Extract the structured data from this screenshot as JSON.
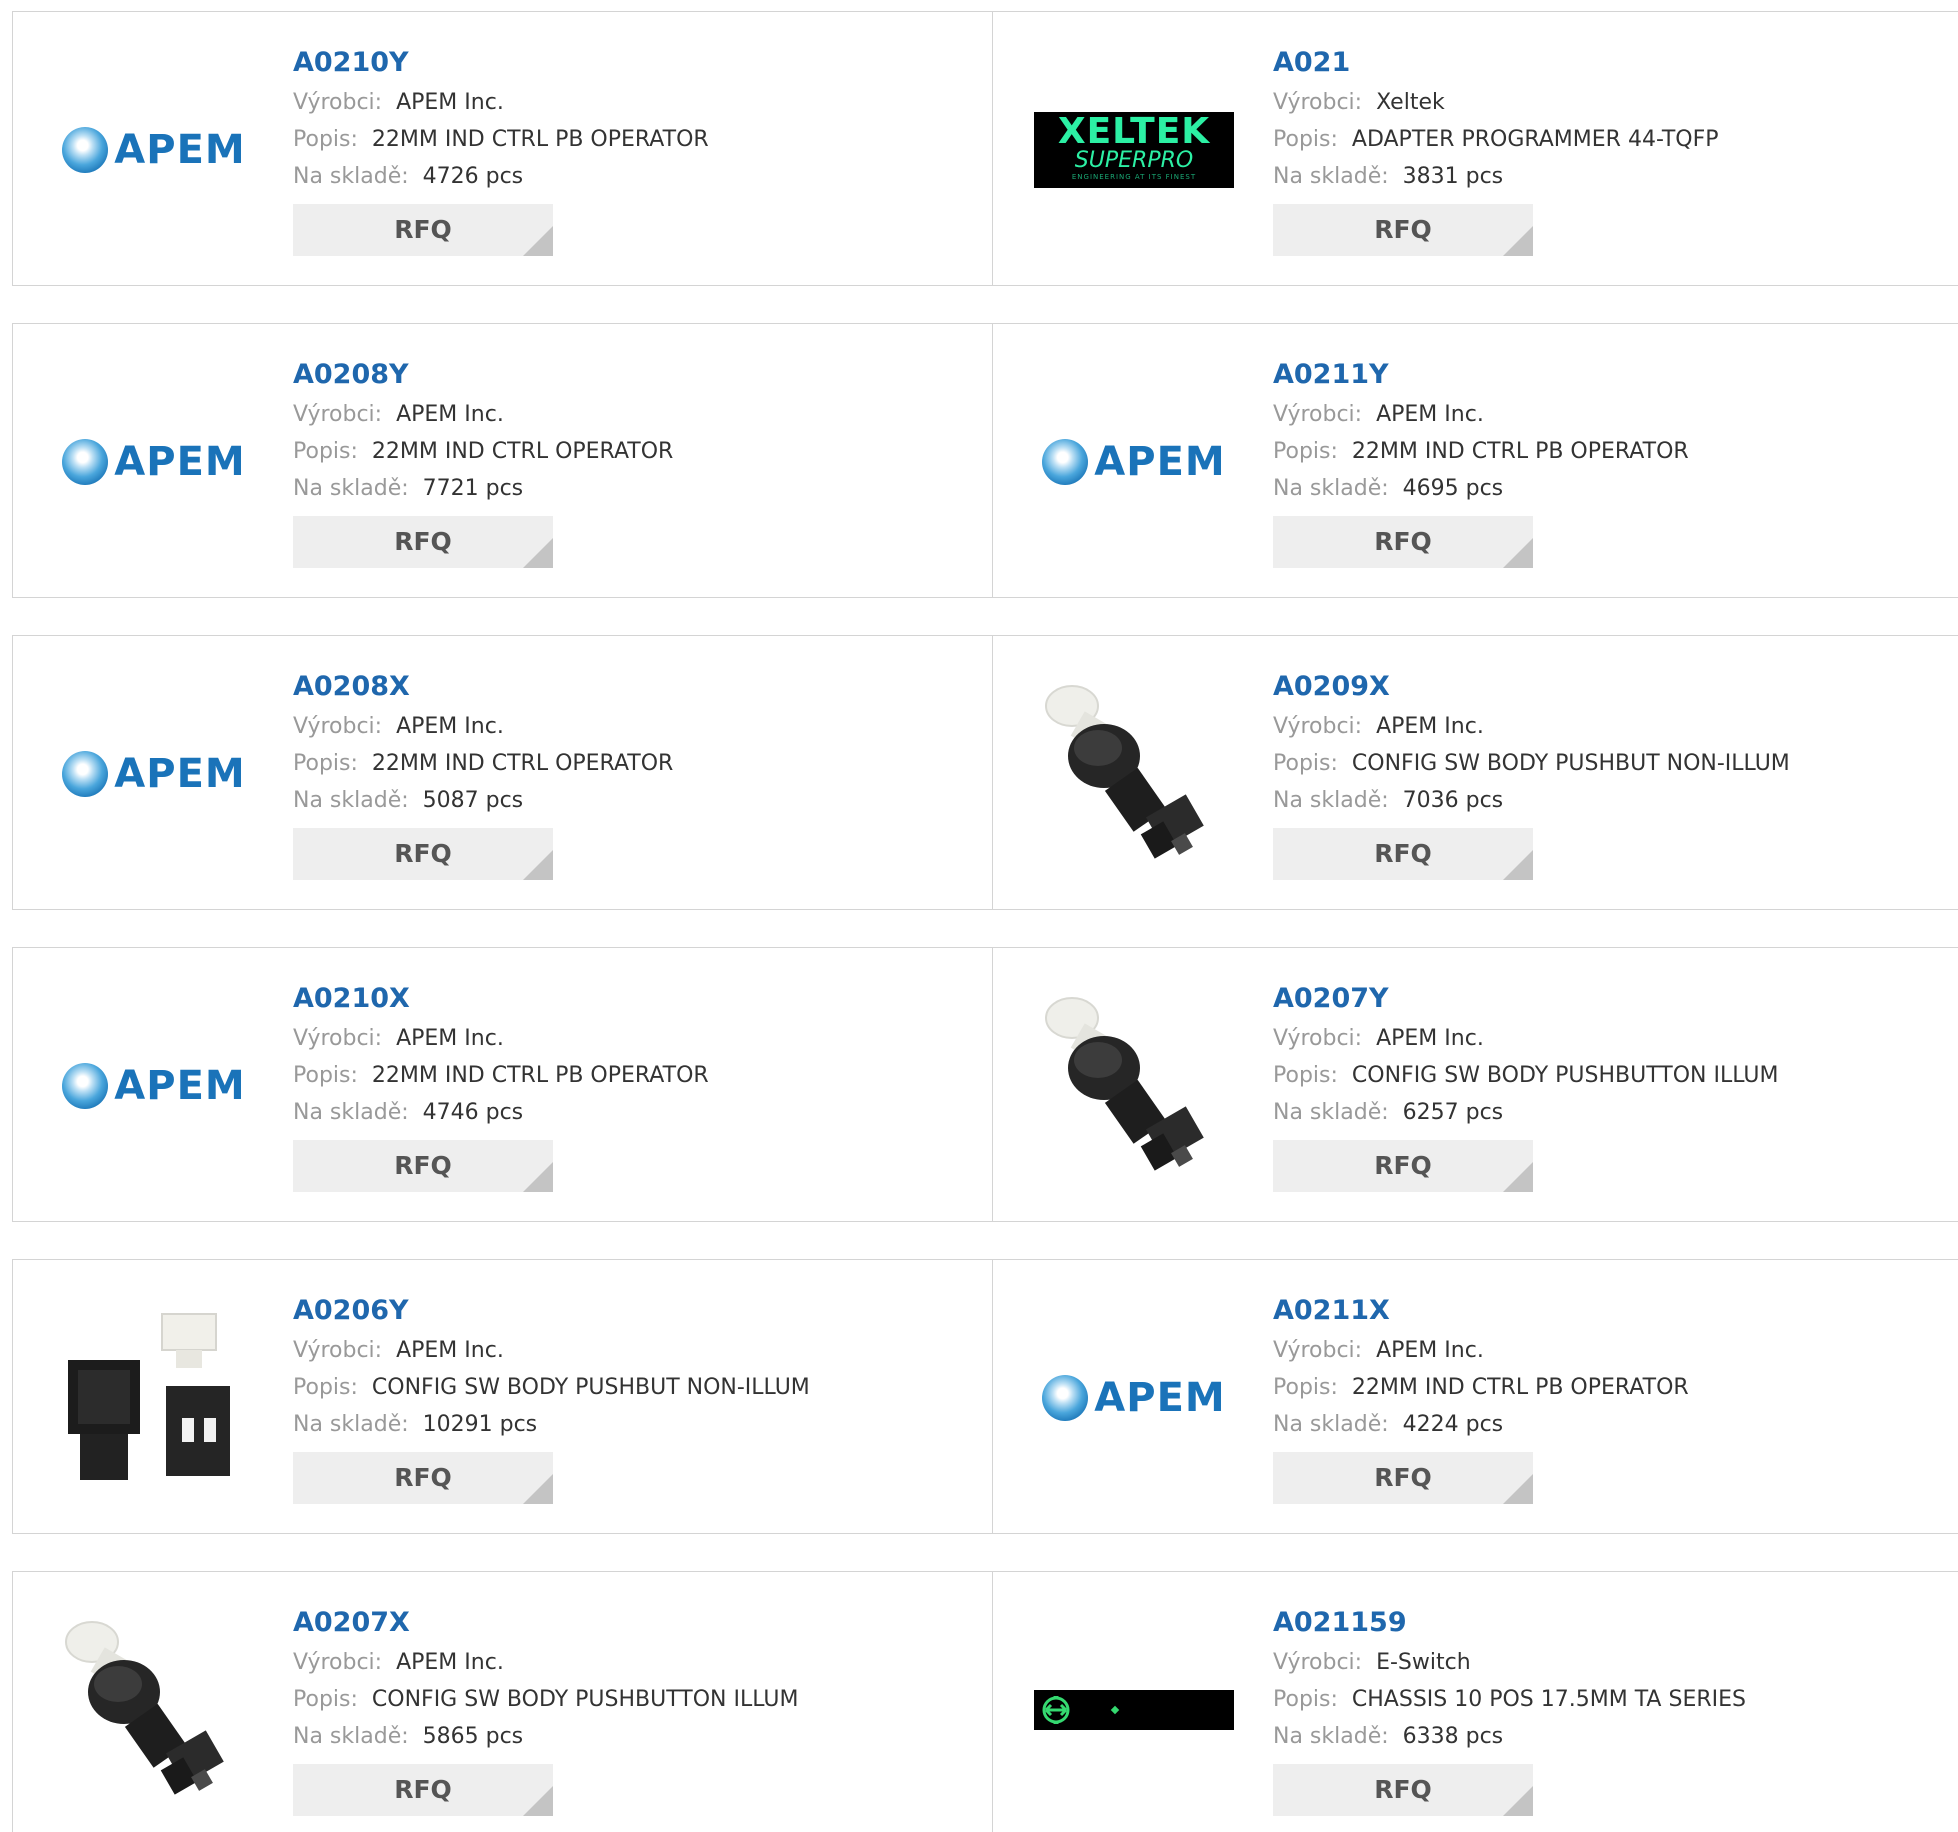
{
  "labels": {
    "manufacturer": "Výrobci:",
    "description": "Popis:",
    "stock": "Na skladě:",
    "rfq": "RFQ"
  },
  "colors": {
    "part_link": "#1f67ad",
    "label_gray": "#999999",
    "rfq_bg": "#eeeeee",
    "border": "#d4d4d4"
  },
  "rows": [
    [
      {
        "part": "A0210Y",
        "manufacturer": "APEM Inc.",
        "description": "22MM IND CTRL PB OPERATOR",
        "stock": "4726 pcs",
        "image": "apem-logo"
      },
      {
        "part": "A021",
        "manufacturer": "Xeltek",
        "description": "ADAPTER PROGRAMMER 44-TQFP",
        "stock": "3831 pcs",
        "image": "xeltek-logo",
        "logo_text": [
          "XELTEK",
          "SUPERPRO",
          "ENGINEERING AT ITS FINEST"
        ]
      }
    ],
    [
      {
        "part": "A0208Y",
        "manufacturer": "APEM Inc.",
        "description": "22MM IND CTRL OPERATOR",
        "stock": "7721 pcs",
        "image": "apem-logo"
      },
      {
        "part": "A0211Y",
        "manufacturer": "APEM Inc.",
        "description": "22MM IND CTRL PB OPERATOR",
        "stock": "4695 pcs",
        "image": "apem-logo"
      }
    ],
    [
      {
        "part": "A0208X",
        "manufacturer": "APEM Inc.",
        "description": "22MM IND CTRL OPERATOR",
        "stock": "5087 pcs",
        "image": "apem-logo"
      },
      {
        "part": "A0209X",
        "manufacturer": "APEM Inc.",
        "description": "CONFIG SW BODY PUSHBUT NON-ILLUM",
        "stock": "7036 pcs",
        "image": "pushbutton-photo"
      }
    ],
    [
      {
        "part": "A0210X",
        "manufacturer": "APEM Inc.",
        "description": "22MM IND CTRL PB OPERATOR",
        "stock": "4746 pcs",
        "image": "apem-logo"
      },
      {
        "part": "A0207Y",
        "manufacturer": "APEM Inc.",
        "description": "CONFIG SW BODY PUSHBUTTON ILLUM",
        "stock": "6257 pcs",
        "image": "pushbutton-photo"
      }
    ],
    [
      {
        "part": "A0206Y",
        "manufacturer": "APEM Inc.",
        "description": "CONFIG SW BODY PUSHBUT NON-ILLUM",
        "stock": "10291 pcs",
        "image": "square-switch-photo"
      },
      {
        "part": "A0211X",
        "manufacturer": "APEM Inc.",
        "description": "22MM IND CTRL PB OPERATOR",
        "stock": "4224 pcs",
        "image": "apem-logo"
      }
    ],
    [
      {
        "part": "A0207X",
        "manufacturer": "APEM Inc.",
        "description": "CONFIG SW BODY PUSHBUTTON ILLUM",
        "stock": "5865 pcs",
        "image": "pushbutton-photo"
      },
      {
        "part": "A021159",
        "manufacturer": "E-Switch",
        "description": "CHASSIS 10 POS 17.5MM TA SERIES",
        "stock": "6338 pcs",
        "image": "chassis-photo"
      }
    ]
  ],
  "apem_logo_text": "APEM"
}
